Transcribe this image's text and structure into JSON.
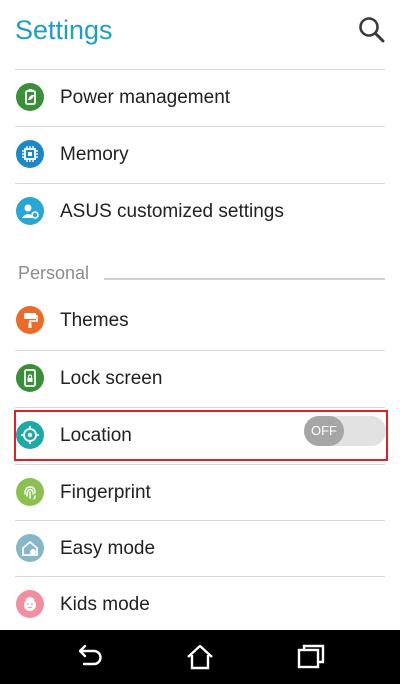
{
  "header": {
    "title": "Settings",
    "search_icon": "search-icon"
  },
  "items_top": [
    {
      "label": "Power management",
      "icon": "battery-leaf-icon",
      "color": "#3b8f3a"
    },
    {
      "label": "Memory",
      "icon": "chip-icon",
      "color": "#1e88c7"
    },
    {
      "label": "ASUS customized settings",
      "icon": "user-gear-icon",
      "color": "#2aa6d6"
    }
  ],
  "section": {
    "label": "Personal"
  },
  "items_personal": [
    {
      "label": "Themes",
      "icon": "paint-roller-icon",
      "color": "#ea6b2a"
    },
    {
      "label": "Lock screen",
      "icon": "phone-lock-icon",
      "color": "#3b8f3a"
    },
    {
      "label": "Location",
      "icon": "location-target-icon",
      "color": "#1fa8a8",
      "toggle": "OFF"
    },
    {
      "label": "Fingerprint",
      "icon": "fingerprint-icon",
      "color": "#8cc152"
    },
    {
      "label": "Easy mode",
      "icon": "home-smile-icon",
      "color": "#86b6c7"
    },
    {
      "label": "Kids mode",
      "icon": "kid-face-icon",
      "color": "#ef8fa0"
    }
  ],
  "navbar": {
    "back_icon": "back-icon",
    "home_icon": "home-icon",
    "recents_icon": "recents-icon"
  },
  "colors": {
    "accent": "#1e9fc2",
    "highlight": "#d9232a",
    "navbar": "#000000"
  }
}
